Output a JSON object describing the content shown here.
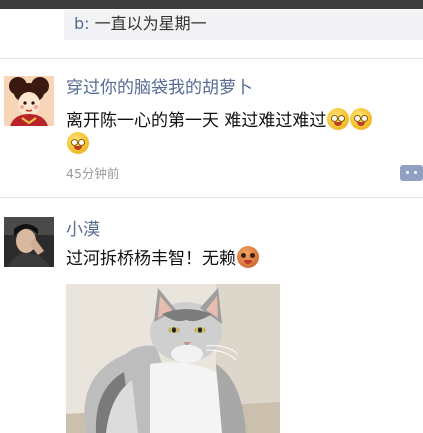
{
  "reply": {
    "name": "b: ",
    "text": "一直以为星期一"
  },
  "posts": [
    {
      "username": "穿过你的脑袋我的胡萝卜",
      "text": "离开陈一心的第一天 难过难过难过",
      "emoji": "blush-face-icon",
      "time": "45分钟前"
    },
    {
      "username": "小漠",
      "text": "过河拆桥杨丰智！无赖",
      "emoji": "cookie-face-icon"
    }
  ],
  "colors": {
    "name_link": "#576b95",
    "reply_bg": "#f3f3f5",
    "divider": "#e4e4e4",
    "time": "#9a9a9a"
  }
}
